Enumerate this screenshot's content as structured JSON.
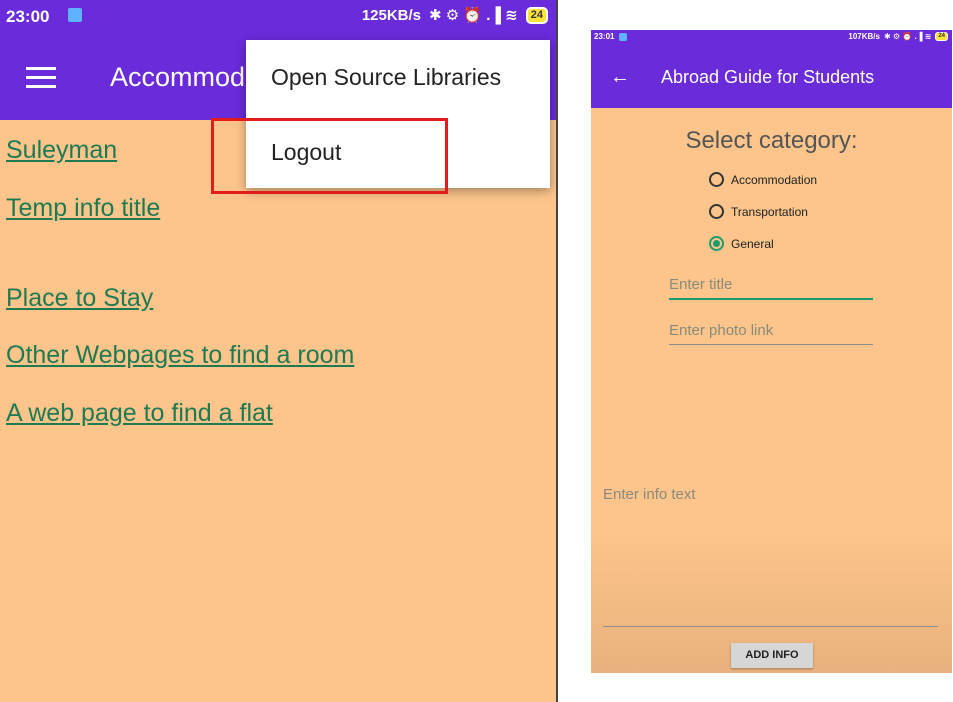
{
  "left_phone": {
    "status": {
      "time": "23:00",
      "network_speed": "125KB/s",
      "status_icons": "✱ ⚙ ⏰ .▐ ≋",
      "battery": "24"
    },
    "appbar": {
      "title": "Accommodation"
    },
    "links": [
      "Suleyman",
      "Temp info title",
      "Place to Stay",
      "Other Webpages to find a room",
      "A web page to find a flat"
    ],
    "overflow_menu": {
      "items": [
        "Open Source Libraries",
        "Logout"
      ]
    }
  },
  "right_phone": {
    "status": {
      "time": "23:01",
      "network_speed": "107KB/s",
      "status_icons": "✱ ⚙ ⏰ .▐ ≋",
      "battery": "24"
    },
    "appbar": {
      "back_glyph": "←",
      "title": "Abroad Guide for Students"
    },
    "form": {
      "category_label": "Select category:",
      "radios": [
        {
          "label": "Accommodation",
          "checked": false
        },
        {
          "label": "Transportation",
          "checked": false
        },
        {
          "label": "General",
          "checked": true
        }
      ],
      "title_placeholder": "Enter title",
      "photo_placeholder": "Enter photo link",
      "info_placeholder": "Enter info text",
      "add_button": "ADD INFO"
    }
  },
  "colors": {
    "primary": "#6a2bdb",
    "background": "#fdc58b",
    "link": "#1f7a52",
    "accent": "#1e9b6c",
    "highlight": "#e21b1b"
  },
  "icons": [
    "notification-icon",
    "menu-icon",
    "back-arrow-icon",
    "radio-icon"
  ]
}
